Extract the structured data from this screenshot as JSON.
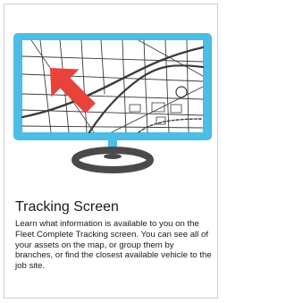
{
  "card": {
    "title": "Tracking Screen",
    "description": "Learn what information is available to you on the Fleet Complete Tracking screen. You can see all of your assets on the map, or group them by branches, or find the closest available vehicle to the job site."
  },
  "illustration": {
    "icon": "monitor-map-icon",
    "colors": {
      "monitor_frame": "#4cbde6",
      "map_background": "#ffffff",
      "streets": "#3b3b3b",
      "arrow": "#e8423b",
      "stand": "#4a4a4a"
    }
  }
}
